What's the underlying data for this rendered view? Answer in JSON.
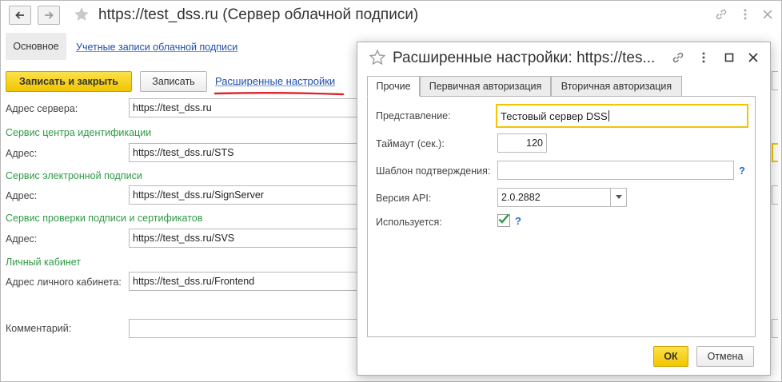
{
  "main": {
    "title": "https://test_dss.ru (Сервер облачной подписи)",
    "tabs": {
      "main_tab": "Основное",
      "accounts_link": "Учетные записи облачной подписи"
    },
    "toolbar": {
      "save_close": "Записать и закрыть",
      "save": "Записать",
      "advanced_link": "Расширенные настройки"
    },
    "form": {
      "server_address_label": "Адрес сервера:",
      "server_address_value": "https://test_dss.ru",
      "id_service_section": "Сервис центра идентификации",
      "id_address_label": "Адрес:",
      "id_address_value": "https://test_dss.ru/STS",
      "sign_service_section": "Сервис электронной подписи",
      "sign_address_label": "Адрес:",
      "sign_address_value": "https://test_dss.ru/SignServer",
      "verify_service_section": "Сервис проверки подписи и сертификатов",
      "verify_address_label": "Адрес:",
      "verify_address_value": "https://test_dss.ru/SVS",
      "cabinet_section": "Личный кабинет",
      "cabinet_address_label": "Адрес личного кабинета:",
      "cabinet_address_value": "https://test_dss.ru/Frontend",
      "comment_label": "Комментарий:",
      "comment_value": ""
    }
  },
  "dialog": {
    "title": "Расширенные настройки: https://tes...",
    "tabs": [
      "Прочие",
      "Первичная авторизация",
      "Вторичная авторизация"
    ],
    "fields": {
      "representation_label": "Представление:",
      "representation_value": "Тестовый сервер DSS",
      "timeout_label": "Таймаут (сек.):",
      "timeout_value": "120",
      "template_label": "Шаблон подтверждения:",
      "template_value": "",
      "api_label": "Версия API:",
      "api_value": "2.0.2882",
      "used_label": "Используется:",
      "used_checked": true,
      "help_mark": "?"
    },
    "buttons": {
      "ok": "ОК",
      "cancel": "Отмена"
    }
  },
  "colors": {
    "accent_yellow": "#f2c500",
    "link_blue": "#1e4ea8",
    "section_green": "#2e9a45",
    "underline_red": "#e0222a",
    "check_green": "#2e9a45"
  }
}
